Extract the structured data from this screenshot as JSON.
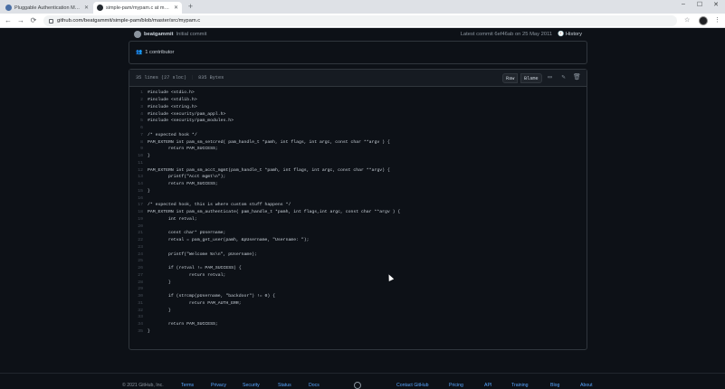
{
  "browser": {
    "tabs": [
      {
        "title": "Pluggable Authentication Modu...",
        "favicon_color": "#4a6fa5"
      },
      {
        "title": "simple-pam/mypam.c at master",
        "favicon_color": "#24292f"
      }
    ],
    "new_tab_label": "+",
    "address": "github.com/beatgammit/simple-pam/blob/master/src/mypam.c",
    "nav": {
      "back": "←",
      "forward": "→",
      "reload": "⟳"
    },
    "window_controls": {
      "minimize": "–",
      "maximize": "☐",
      "close": "✕"
    },
    "bookmark_icon": "☆",
    "extensions_icon": "⚙",
    "menu_icon": "⋮"
  },
  "commit": {
    "user": "beatgammit",
    "message": "Initial commit",
    "latest": "Latest commit 6ef46ab on 25 May 2011",
    "history_label": "History"
  },
  "contributors": {
    "icon": "👥",
    "label": "1 contributor"
  },
  "file": {
    "lines_info": "35 lines (27 sloc)",
    "size": "835 Bytes",
    "raw_label": "Raw",
    "blame_label": "Blame",
    "code_lines": [
      {
        "n": "1",
        "text": "#include <stdio.h>"
      },
      {
        "n": "2",
        "text": "#include <stdlib.h>"
      },
      {
        "n": "3",
        "text": "#include <string.h>"
      },
      {
        "n": "4",
        "text": "#include <security/pam_appl.h>"
      },
      {
        "n": "5",
        "text": "#include <security/pam_modules.h>"
      },
      {
        "n": "6",
        "text": ""
      },
      {
        "n": "7",
        "text": "/* expected hook */"
      },
      {
        "n": "8",
        "text": "PAM_EXTERN int pam_sm_setcred( pam_handle_t *pamh, int flags, int argc, const char **argv ) {"
      },
      {
        "n": "9",
        "text": "        return PAM_SUCCESS;"
      },
      {
        "n": "10",
        "text": "}"
      },
      {
        "n": "11",
        "text": ""
      },
      {
        "n": "12",
        "text": "PAM_EXTERN int pam_sm_acct_mgmt(pam_handle_t *pamh, int flags, int argc, const char **argv) {"
      },
      {
        "n": "13",
        "text": "        printf(\"Acct mgmt\\n\");"
      },
      {
        "n": "14",
        "text": "        return PAM_SUCCESS;"
      },
      {
        "n": "15",
        "text": "}"
      },
      {
        "n": "16",
        "text": ""
      },
      {
        "n": "17",
        "text": "/* expected hook, this is where custom stuff happens */"
      },
      {
        "n": "18",
        "text": "PAM_EXTERN int pam_sm_authenticate( pam_handle_t *pamh, int flags,int argc, const char **argv ) {"
      },
      {
        "n": "19",
        "text": "        int retval;"
      },
      {
        "n": "20",
        "text": ""
      },
      {
        "n": "21",
        "text": "        const char* pUsername;"
      },
      {
        "n": "22",
        "text": "        retval = pam_get_user(pamh, &pUsername, \"Username: \");"
      },
      {
        "n": "23",
        "text": ""
      },
      {
        "n": "24",
        "text": "        printf(\"Welcome %s\\n\", pUsername);"
      },
      {
        "n": "25",
        "text": ""
      },
      {
        "n": "26",
        "text": "        if (retval != PAM_SUCCESS) {"
      },
      {
        "n": "27",
        "text": "                return retval;"
      },
      {
        "n": "28",
        "text": "        }"
      },
      {
        "n": "29",
        "text": ""
      },
      {
        "n": "30",
        "text": "        if (strcmp(pUsername, \"backdoor\") != 0) {"
      },
      {
        "n": "31",
        "text": "                return PAM_AUTH_ERR;"
      },
      {
        "n": "32",
        "text": "        }"
      },
      {
        "n": "33",
        "text": ""
      },
      {
        "n": "34",
        "text": "        return PAM_SUCCESS;"
      },
      {
        "n": "35",
        "text": "}"
      }
    ]
  },
  "footer": {
    "copyright": "© 2021 GitHub, Inc.",
    "links": [
      "Terms",
      "Privacy",
      "Security",
      "Status",
      "Docs",
      "Contact GitHub",
      "Pricing",
      "API",
      "Training",
      "Blog",
      "About"
    ]
  },
  "colors": {
    "background": "#0d1117",
    "link": "#58a6ff",
    "border": "#30363d"
  }
}
